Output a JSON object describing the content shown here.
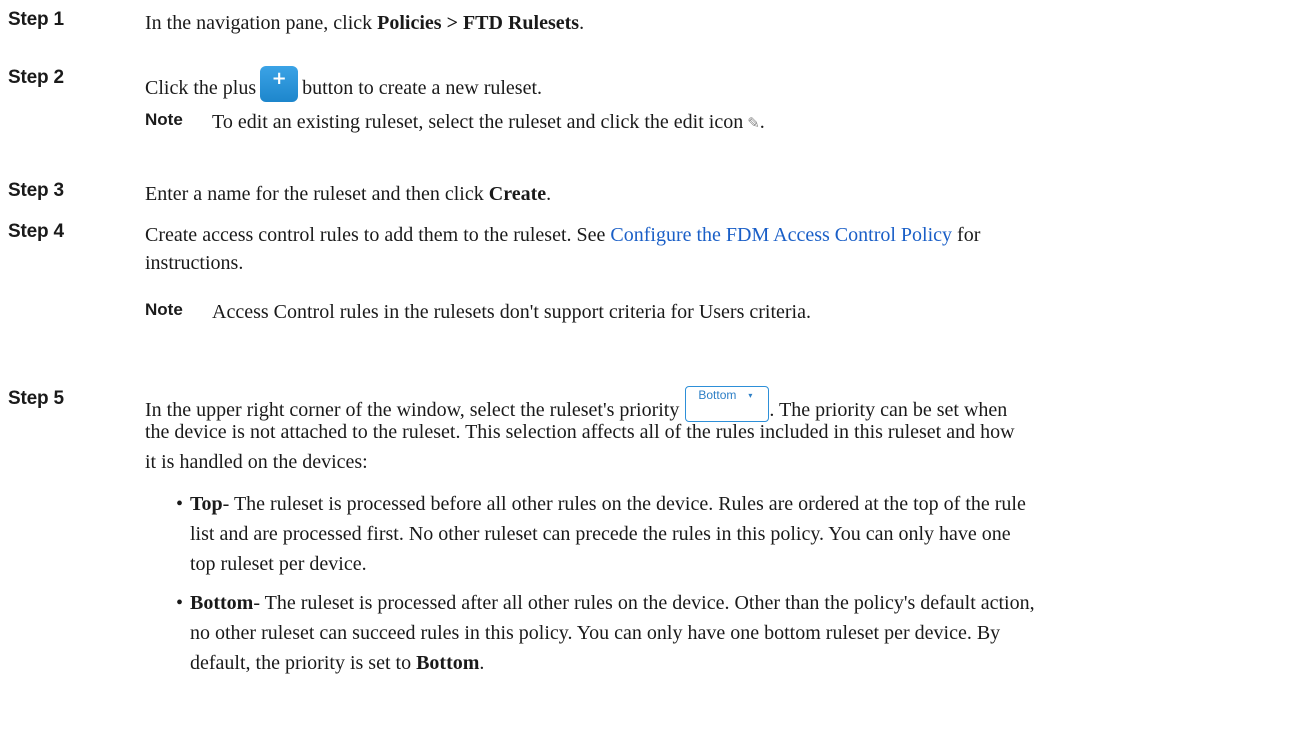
{
  "steps": [
    {
      "label": "Step 1",
      "s1_pre": "In the navigation pane, click ",
      "s1_bold": "Policies > FTD Rulesets",
      "s1_post": "."
    },
    {
      "label": "Step 2",
      "pre": "Click the plus",
      "plus_glyph": "+",
      "post": "button to create a new ruleset.",
      "note_label": "Note",
      "note_text": "To edit an existing ruleset, select the ruleset and click the edit icon",
      "pencil_glyph": "✎",
      "note_end": "."
    },
    {
      "label": "Step 3",
      "pre": "Enter a name for the ruleset and then click ",
      "bold": "Create",
      "post": "."
    },
    {
      "label": "Step 4",
      "pre": "Create access control rules to add them to the ruleset. See ",
      "link": "Configure the FDM Access Control Policy",
      "post": " for",
      "line2": "instructions.",
      "note_label": "Note",
      "note_text": "Access Control rules in the rulesets don't support criteria for Users criteria."
    },
    {
      "label": "Step 5",
      "pre": "In the upper right corner of the window, select the ruleset's priority",
      "button_label": "Bottom",
      "caret": "▾",
      "post": ". The priority can be set when",
      "line2": "the device is not attached to the ruleset. This selection affects all of the rules included in this ruleset and how",
      "line3": "it is handled on the devices:"
    }
  ],
  "bullets": [
    {
      "term": "Top",
      "line1": "- The ruleset is processed before all other rules on the device. Rules are ordered at the top of the rule",
      "line2": "list and are processed first. No other ruleset can precede the rules in this policy. You can only have one",
      "line3": "top ruleset per device."
    },
    {
      "term": "Bottom",
      "line1": "- The ruleset is processed after all other rules on the device. Other than the policy's default action,",
      "line2": "no other ruleset can succeed rules in this policy. You can only have one bottom ruleset per device. By",
      "line3_pre": "default, the priority is set to ",
      "line3_bold": "Bottom",
      "line3_post": "."
    }
  ],
  "colors": {
    "link": "#1a5fc7",
    "plus_button": "#2592d8",
    "text": "#1a1a1a"
  }
}
